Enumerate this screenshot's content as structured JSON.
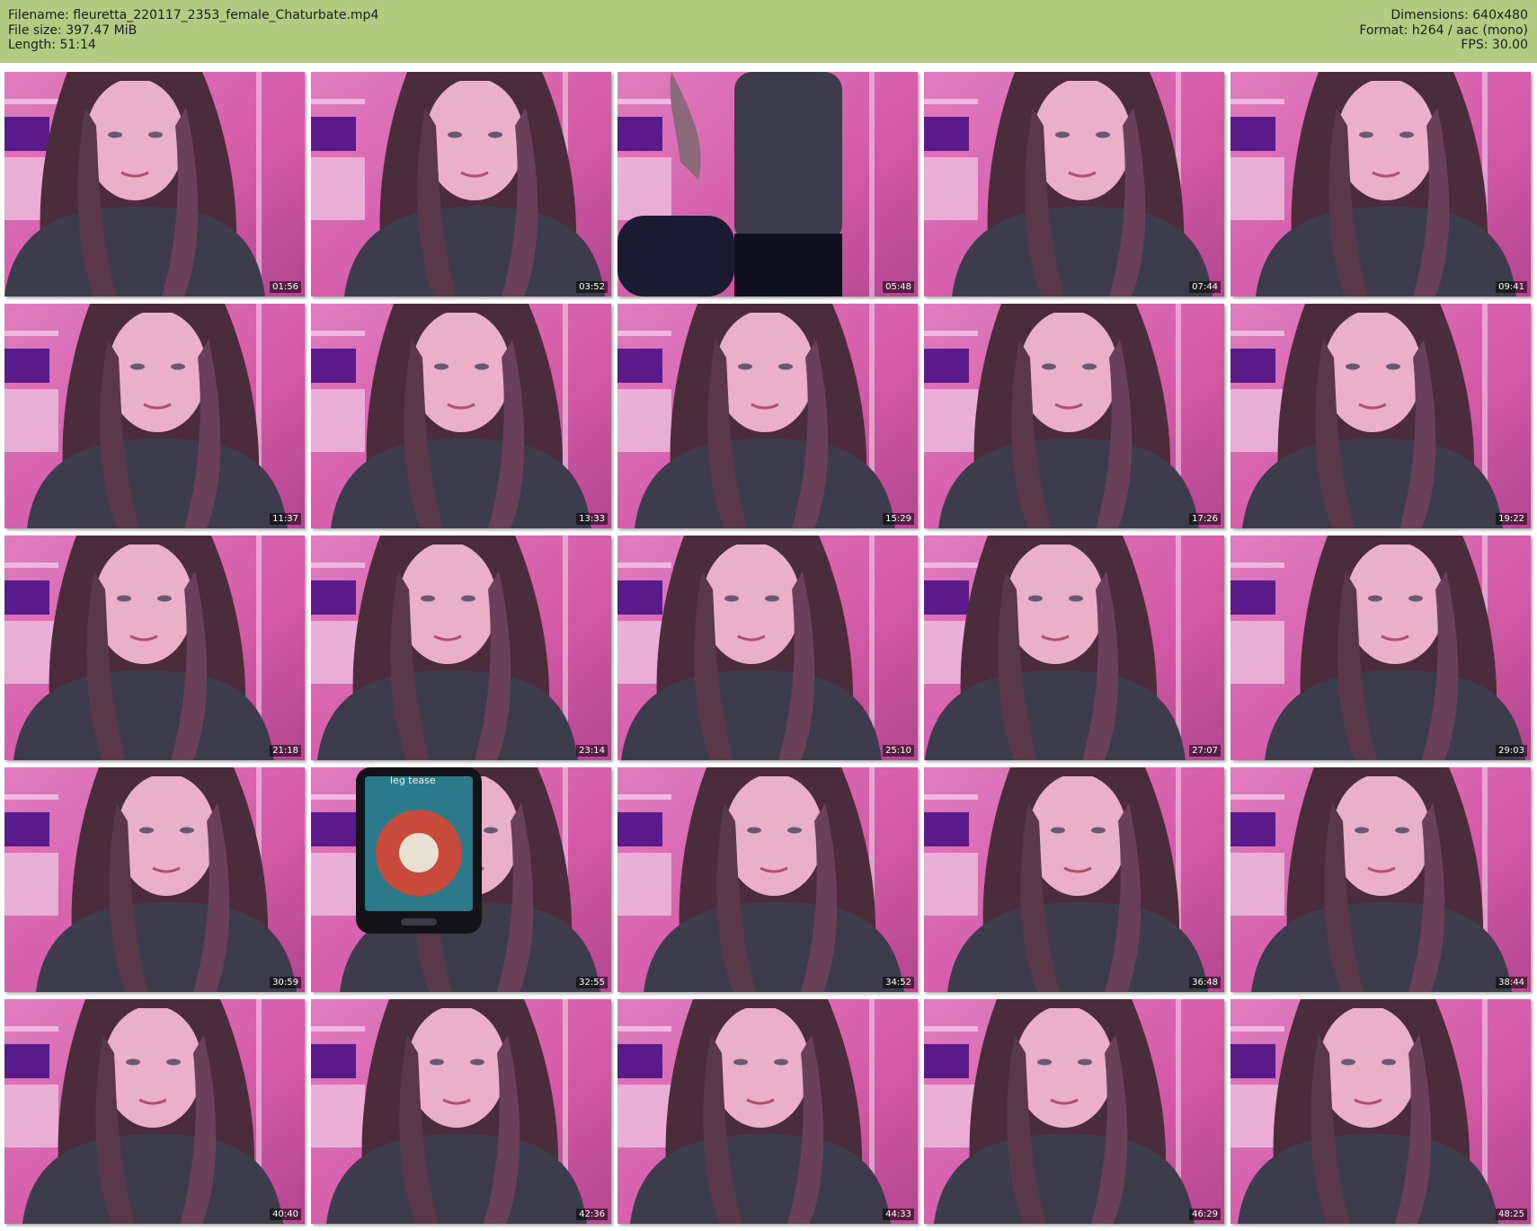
{
  "header": {
    "filename_label": "Filename: fleuretta_220117_2353_female_Chaturbate.mp4",
    "filesize_label": "File size: 397.47 MiB",
    "length_label": "Length: 51:14",
    "dimensions_label": "Dimensions: 640x480",
    "format_label": "Format: h264 / aac (mono)",
    "fps_label": "FPS: 30.00"
  },
  "colors": {
    "header_bg": "#b0cc80",
    "wall": "#d45aa8",
    "hair": "#4a2c3a",
    "skin": "#e9b0c8",
    "shirt": "#3c3c4c"
  },
  "thumbnails": [
    {
      "timestamp": "01:56"
    },
    {
      "timestamp": "03:52"
    },
    {
      "timestamp": "05:48"
    },
    {
      "timestamp": "07:44"
    },
    {
      "timestamp": "09:41"
    },
    {
      "timestamp": "11:37"
    },
    {
      "timestamp": "13:33"
    },
    {
      "timestamp": "15:29"
    },
    {
      "timestamp": "17:26"
    },
    {
      "timestamp": "19:22"
    },
    {
      "timestamp": "21:18"
    },
    {
      "timestamp": "23:14"
    },
    {
      "timestamp": "25:10"
    },
    {
      "timestamp": "27:07"
    },
    {
      "timestamp": "29:03"
    },
    {
      "timestamp": "30:59"
    },
    {
      "timestamp": "32:55",
      "overlay_text": "leg tease"
    },
    {
      "timestamp": "34:52"
    },
    {
      "timestamp": "36:48"
    },
    {
      "timestamp": "38:44"
    },
    {
      "timestamp": "40:40"
    },
    {
      "timestamp": "42:36"
    },
    {
      "timestamp": "44:33"
    },
    {
      "timestamp": "46:29"
    },
    {
      "timestamp": "48:25"
    }
  ]
}
